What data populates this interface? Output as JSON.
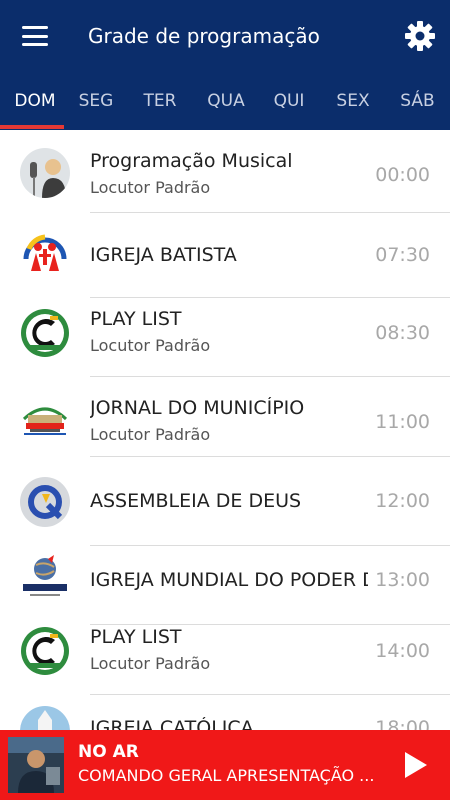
{
  "header": {
    "title": "Grade de programação"
  },
  "tabs": [
    {
      "label": "DOM"
    },
    {
      "label": "SEG"
    },
    {
      "label": "TER"
    },
    {
      "label": "QUA"
    },
    {
      "label": "QUI"
    },
    {
      "label": "SEX"
    },
    {
      "label": "SÁB"
    }
  ],
  "active_tab": "DOM",
  "schedule": [
    {
      "name": "Programação Musical",
      "host": "Locutor Padrão",
      "time": "00:00",
      "logo": "host-photo-icon"
    },
    {
      "name": "IGREJA BATISTA",
      "host": "",
      "time": "07:30",
      "logo": "church-logo-icon"
    },
    {
      "name": "PLAY LIST",
      "host": "Locutor Padrão",
      "time": "08:30",
      "logo": "radio-logo-icon"
    },
    {
      "name": "JORNAL DO MUNICÍPIO",
      "host": "Locutor Padrão",
      "time": "11:00",
      "logo": "city-logo-icon"
    },
    {
      "name": "ASSEMBLEIA DE DEUS",
      "host": "",
      "time": "12:00",
      "logo": "assembly-logo-icon"
    },
    {
      "name": "IGREJA MUNDIAL DO PODER DE DEUS",
      "host": "",
      "time": "13:00",
      "logo": "mundial-logo-icon"
    },
    {
      "name": "PLAY LIST",
      "host": "Locutor Padrão",
      "time": "14:00",
      "logo": "radio-logo-icon"
    },
    {
      "name": "IGREJA CATÓLICA",
      "host": "",
      "time": "18:00",
      "logo": "catholic-church-icon"
    }
  ],
  "player": {
    "status": "NO AR",
    "program": "COMANDO GERAL APRESENTAÇÃO ..."
  },
  "colors": {
    "header": "#0b2d6b",
    "accent": "#e53935",
    "player": "#f01818"
  }
}
